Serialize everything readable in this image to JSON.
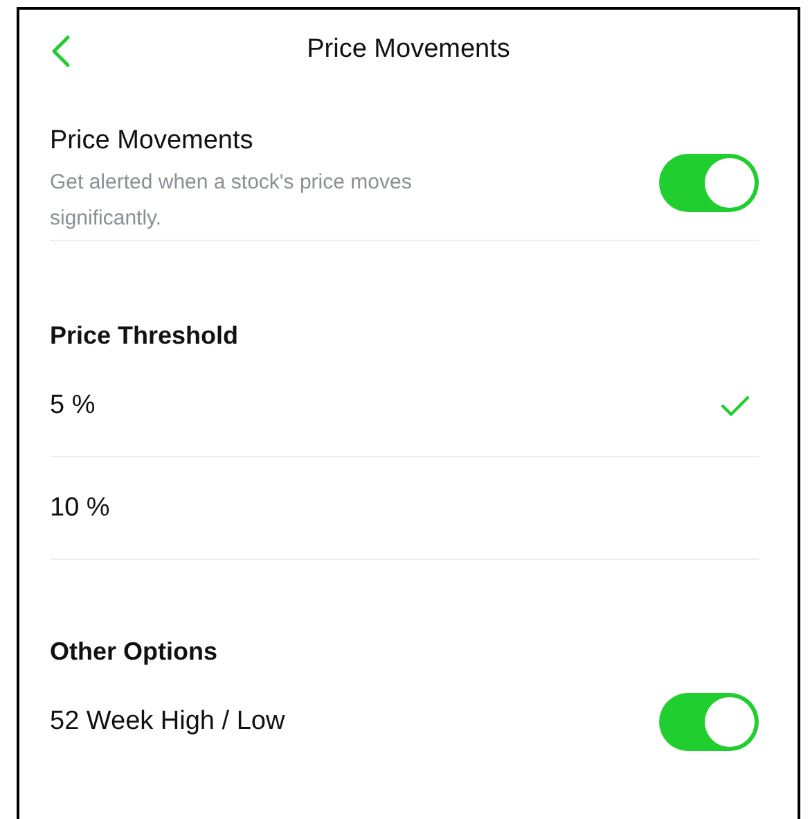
{
  "header": {
    "title": "Price Movements"
  },
  "alert": {
    "title": "Price Movements",
    "description": "Get alerted when a stock's price moves significantly.",
    "on": true
  },
  "threshold": {
    "heading": "Price Threshold",
    "options": [
      {
        "label": "5 %",
        "selected": true
      },
      {
        "label": "10 %",
        "selected": false
      }
    ]
  },
  "other": {
    "heading": "Other Options",
    "items": [
      {
        "label": "52 Week High / Low",
        "on": true
      }
    ]
  }
}
